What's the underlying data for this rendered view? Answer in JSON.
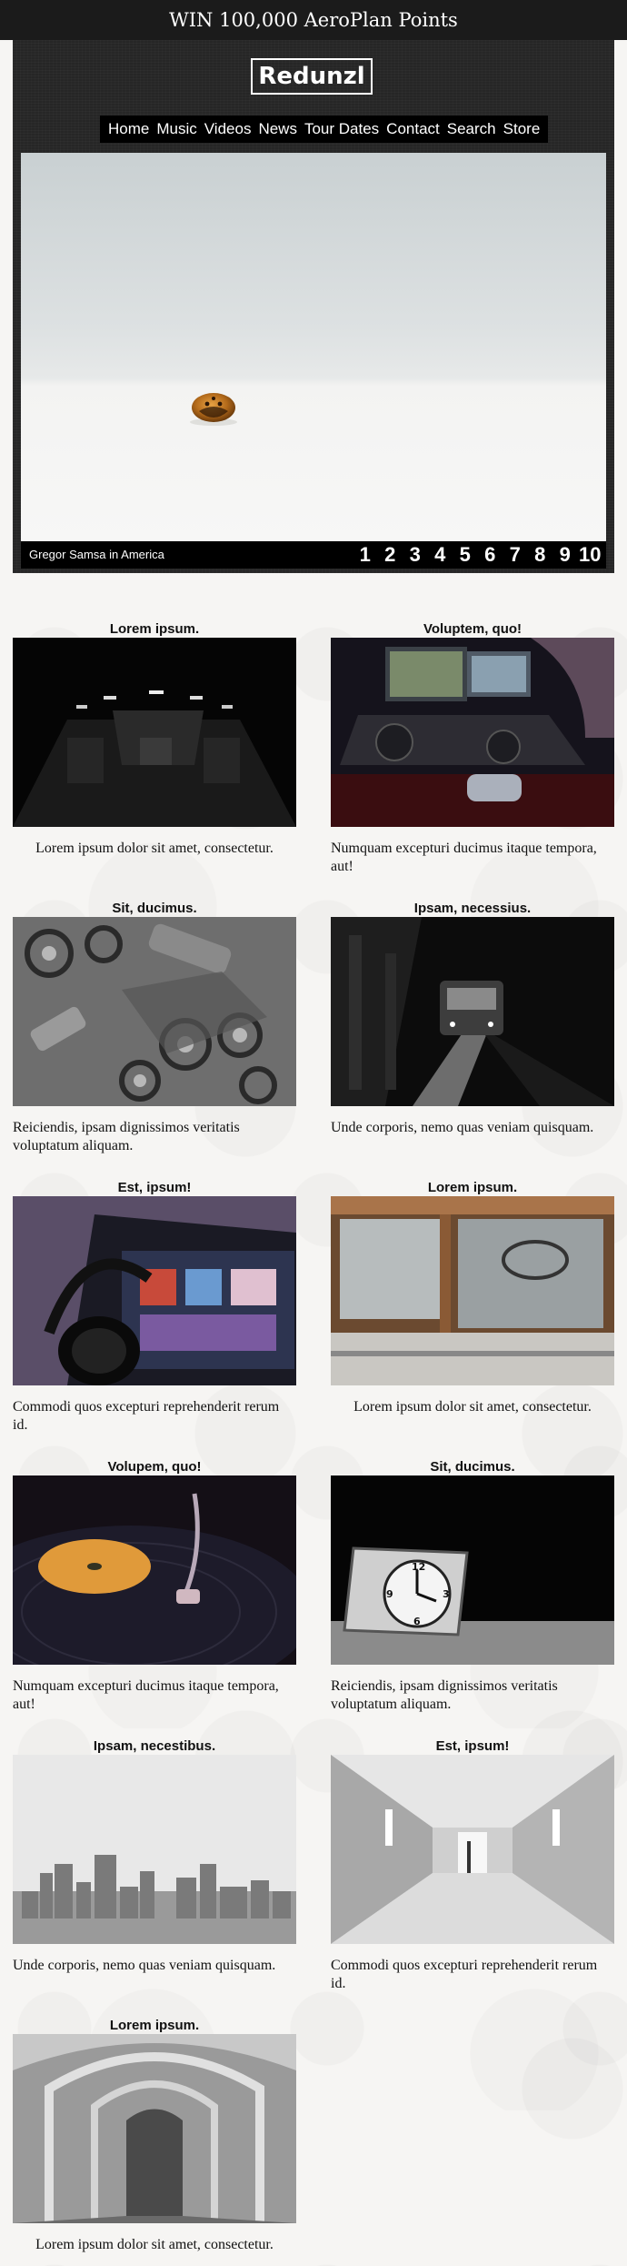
{
  "promo": {
    "text": "WIN 100,000 AeroPlan Points"
  },
  "logo": {
    "text": "Redunzl"
  },
  "nav": {
    "items": [
      "Home",
      "Music",
      "Videos",
      "News",
      "Tour Dates",
      "Contact",
      "Search",
      "Store"
    ]
  },
  "slider": {
    "caption": "Gregor Samsa in America",
    "pages": [
      "1",
      "2",
      "3",
      "4",
      "5",
      "6",
      "7",
      "8",
      "9",
      "10"
    ]
  },
  "cards": [
    {
      "title": "Lorem ipsum.",
      "text": "Lorem ipsum dolor sit amet, consectetur.",
      "image": "dark-tunnel-photo"
    },
    {
      "title": "Voluptem, quo!",
      "text": "Numquam excepturi ducimus itaque tempora, aut!",
      "image": "dj-laptop-photo"
    },
    {
      "title": "Sit, ducimus.",
      "text": "Reiciendis, ipsam dignissimos veritatis voluptatum aliquam.",
      "image": "gears-photo"
    },
    {
      "title": "Ipsam, necessius.",
      "text": "Unde corporis, nemo quas veniam quisquam.",
      "image": "subway-train-photo"
    },
    {
      "title": "Est, ipsum!",
      "text": "Commodi quos excepturi reprehenderit rerum id.",
      "image": "headphones-screen-photo"
    },
    {
      "title": "Lorem ipsum.",
      "text": "Lorem ipsum dolor sit amet, consectetur.",
      "image": "vintage-car-photo"
    },
    {
      "title": "Volupem, quo!",
      "text": "Numquam excepturi ducimus itaque tempora, aut!",
      "image": "vinyl-record-photo"
    },
    {
      "title": "Sit, ducimus.",
      "text": "Reiciendis, ipsam dignissimos veritatis voluptatum aliquam.",
      "image": "alarm-clock-photo"
    },
    {
      "title": "Ipsam, necestibus.",
      "text": "Unde corporis, nemo quas veniam quisquam.",
      "image": "city-skyline-photo"
    },
    {
      "title": "Est, ipsum!",
      "text": "Commodi quos excepturi reprehenderit rerum id.",
      "image": "hallway-photo"
    },
    {
      "title": "Lorem ipsum.",
      "text": "Lorem ipsum dolor sit amet, consectetur.",
      "image": "cloister-arches-photo"
    }
  ],
  "colors": {
    "promo_bg": "#1b1b1b",
    "header_bg": "#262626",
    "nav_bg": "#000000"
  }
}
